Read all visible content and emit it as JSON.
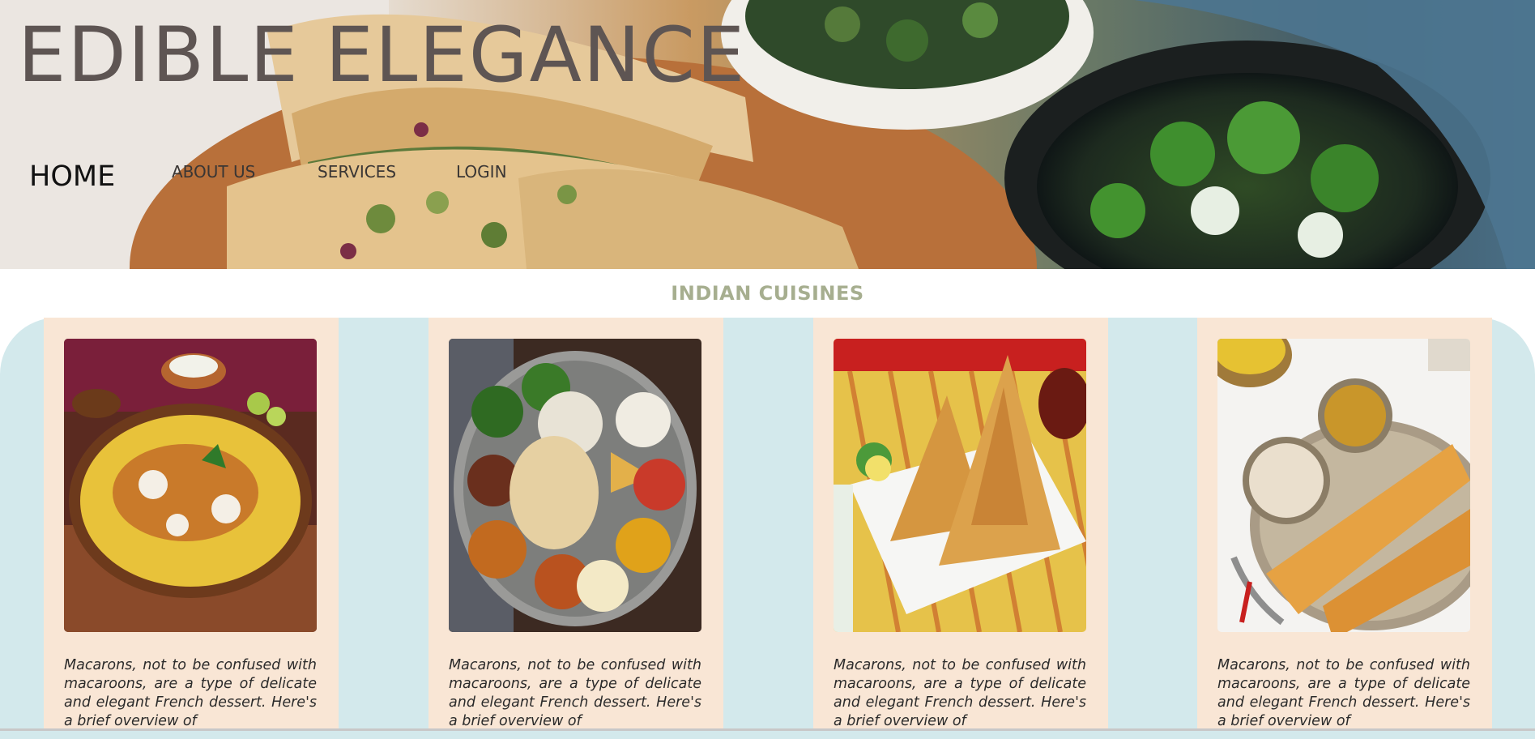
{
  "site": {
    "title": "EDIBLE ELEGANCE"
  },
  "nav": {
    "items": [
      {
        "label": "HOME"
      },
      {
        "label": "ABOUT US"
      },
      {
        "label": "SERVICES"
      },
      {
        "label": "LOGIN"
      }
    ]
  },
  "section": {
    "title": "INDIAN CUISINES"
  },
  "cards": [
    {
      "description": "Macarons, not to be confused with macaroons, are a type of delicate and elegant French dessert. Here's a brief overview of"
    },
    {
      "description": "Macarons, not to be confused with macaroons, are a type of delicate and elegant French dessert. Here's a brief overview of"
    },
    {
      "description": "Macarons, not to be confused with macaroons, are a type of delicate and elegant French dessert. Here's a brief overview of"
    },
    {
      "description": "Macarons, not to be confused with macaroons, are a type of delicate and elegant French dessert. Here's a brief overview of"
    }
  ],
  "colors": {
    "band": "#d3e9ec",
    "card": "#f9e6d5",
    "section_title": "#a6ae8f",
    "brand": "#5e5553"
  }
}
